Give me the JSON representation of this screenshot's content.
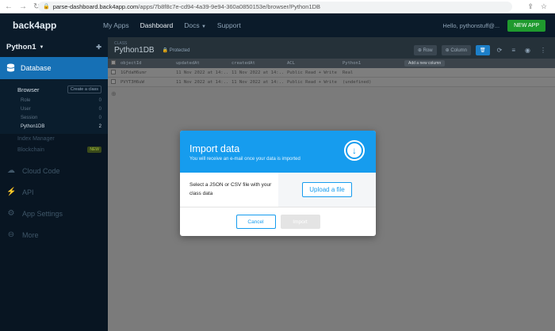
{
  "browser": {
    "url_host": "parse-dashboard.back4app.com",
    "url_path": "/apps/7b8f8c7e-cd94-4a39-9e94-360a0850153e/browser/Python1DB"
  },
  "topbar": {
    "brand": "back4app",
    "nav": [
      "My Apps",
      "Dashboard",
      "Docs",
      "Support"
    ],
    "hello": "Hello, pythonstuff@...",
    "new_app": "NEW APP"
  },
  "sidebar": {
    "app_name": "Python1",
    "database_label": "Database",
    "browser_label": "Browser",
    "create_class": "Create a class",
    "classes": [
      {
        "name": "Role",
        "count": "0"
      },
      {
        "name": "User",
        "count": "0"
      },
      {
        "name": "Session",
        "count": "0"
      },
      {
        "name": "Python1DB",
        "count": "2"
      }
    ],
    "index_manager": "Index Manager",
    "blockchain": "Blockchain",
    "new_badge": "NEW",
    "cloud_code": "Cloud Code",
    "api": "API",
    "app_settings": "App Settings",
    "more": "More"
  },
  "toolbar": {
    "class_label": "CLASS",
    "class_name": "Python1DB",
    "protected": "Protected",
    "row_btn": "Row",
    "column_btn": "Column"
  },
  "grid": {
    "columns": [
      "objectId",
      "updatedAt",
      "createdAt",
      "ACL",
      "Python1"
    ],
    "add_column": "Add a new column",
    "rows": [
      [
        "1GFdaH6umr",
        "11 Nov 2022 at 14:...",
        "11 Nov 2022 at 14:...",
        "Public Read + Write",
        "Real"
      ],
      [
        "PVYT3H6uW",
        "11 Nov 2022 at 14:...",
        "11 Nov 2022 at 14:...",
        "Public Read + Write",
        "(undefined)"
      ]
    ]
  },
  "modal": {
    "title": "Import data",
    "subtitle": "You will receive an e-mail once your data is imported",
    "body_label": "Select a JSON or CSV file with your class data",
    "upload_btn": "Upload a file",
    "cancel_btn": "Cancel",
    "import_btn": "Import",
    "colors": {
      "accent": "#169cee",
      "disabled": "#e4e4e4"
    }
  },
  "icons": [
    "back-icon",
    "forward-icon",
    "reload-icon",
    "lock-icon",
    "share-icon",
    "star-icon",
    "download-icon",
    "database-icon",
    "pin-icon",
    "cloud-code-icon",
    "api-icon",
    "settings-icon",
    "more-icon",
    "refresh-icon",
    "filter-icon",
    "eye-icon",
    "trash-icon",
    "plus-icon"
  ]
}
